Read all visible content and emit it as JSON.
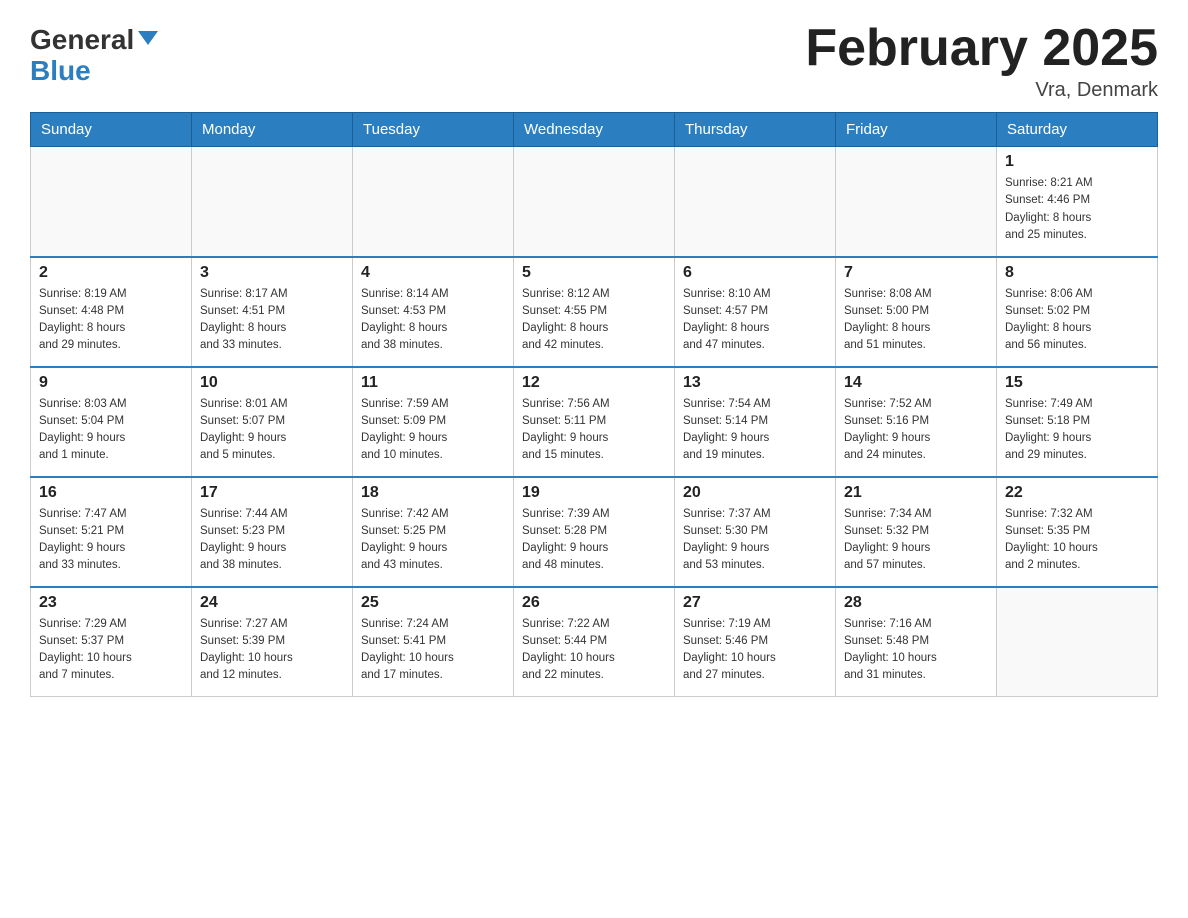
{
  "header": {
    "logo_general": "General",
    "logo_blue": "Blue",
    "title": "February 2025",
    "location": "Vra, Denmark"
  },
  "weekdays": [
    "Sunday",
    "Monday",
    "Tuesday",
    "Wednesday",
    "Thursday",
    "Friday",
    "Saturday"
  ],
  "weeks": [
    [
      {
        "day": "",
        "info": ""
      },
      {
        "day": "",
        "info": ""
      },
      {
        "day": "",
        "info": ""
      },
      {
        "day": "",
        "info": ""
      },
      {
        "day": "",
        "info": ""
      },
      {
        "day": "",
        "info": ""
      },
      {
        "day": "1",
        "info": "Sunrise: 8:21 AM\nSunset: 4:46 PM\nDaylight: 8 hours\nand 25 minutes."
      }
    ],
    [
      {
        "day": "2",
        "info": "Sunrise: 8:19 AM\nSunset: 4:48 PM\nDaylight: 8 hours\nand 29 minutes."
      },
      {
        "day": "3",
        "info": "Sunrise: 8:17 AM\nSunset: 4:51 PM\nDaylight: 8 hours\nand 33 minutes."
      },
      {
        "day": "4",
        "info": "Sunrise: 8:14 AM\nSunset: 4:53 PM\nDaylight: 8 hours\nand 38 minutes."
      },
      {
        "day": "5",
        "info": "Sunrise: 8:12 AM\nSunset: 4:55 PM\nDaylight: 8 hours\nand 42 minutes."
      },
      {
        "day": "6",
        "info": "Sunrise: 8:10 AM\nSunset: 4:57 PM\nDaylight: 8 hours\nand 47 minutes."
      },
      {
        "day": "7",
        "info": "Sunrise: 8:08 AM\nSunset: 5:00 PM\nDaylight: 8 hours\nand 51 minutes."
      },
      {
        "day": "8",
        "info": "Sunrise: 8:06 AM\nSunset: 5:02 PM\nDaylight: 8 hours\nand 56 minutes."
      }
    ],
    [
      {
        "day": "9",
        "info": "Sunrise: 8:03 AM\nSunset: 5:04 PM\nDaylight: 9 hours\nand 1 minute."
      },
      {
        "day": "10",
        "info": "Sunrise: 8:01 AM\nSunset: 5:07 PM\nDaylight: 9 hours\nand 5 minutes."
      },
      {
        "day": "11",
        "info": "Sunrise: 7:59 AM\nSunset: 5:09 PM\nDaylight: 9 hours\nand 10 minutes."
      },
      {
        "day": "12",
        "info": "Sunrise: 7:56 AM\nSunset: 5:11 PM\nDaylight: 9 hours\nand 15 minutes."
      },
      {
        "day": "13",
        "info": "Sunrise: 7:54 AM\nSunset: 5:14 PM\nDaylight: 9 hours\nand 19 minutes."
      },
      {
        "day": "14",
        "info": "Sunrise: 7:52 AM\nSunset: 5:16 PM\nDaylight: 9 hours\nand 24 minutes."
      },
      {
        "day": "15",
        "info": "Sunrise: 7:49 AM\nSunset: 5:18 PM\nDaylight: 9 hours\nand 29 minutes."
      }
    ],
    [
      {
        "day": "16",
        "info": "Sunrise: 7:47 AM\nSunset: 5:21 PM\nDaylight: 9 hours\nand 33 minutes."
      },
      {
        "day": "17",
        "info": "Sunrise: 7:44 AM\nSunset: 5:23 PM\nDaylight: 9 hours\nand 38 minutes."
      },
      {
        "day": "18",
        "info": "Sunrise: 7:42 AM\nSunset: 5:25 PM\nDaylight: 9 hours\nand 43 minutes."
      },
      {
        "day": "19",
        "info": "Sunrise: 7:39 AM\nSunset: 5:28 PM\nDaylight: 9 hours\nand 48 minutes."
      },
      {
        "day": "20",
        "info": "Sunrise: 7:37 AM\nSunset: 5:30 PM\nDaylight: 9 hours\nand 53 minutes."
      },
      {
        "day": "21",
        "info": "Sunrise: 7:34 AM\nSunset: 5:32 PM\nDaylight: 9 hours\nand 57 minutes."
      },
      {
        "day": "22",
        "info": "Sunrise: 7:32 AM\nSunset: 5:35 PM\nDaylight: 10 hours\nand 2 minutes."
      }
    ],
    [
      {
        "day": "23",
        "info": "Sunrise: 7:29 AM\nSunset: 5:37 PM\nDaylight: 10 hours\nand 7 minutes."
      },
      {
        "day": "24",
        "info": "Sunrise: 7:27 AM\nSunset: 5:39 PM\nDaylight: 10 hours\nand 12 minutes."
      },
      {
        "day": "25",
        "info": "Sunrise: 7:24 AM\nSunset: 5:41 PM\nDaylight: 10 hours\nand 17 minutes."
      },
      {
        "day": "26",
        "info": "Sunrise: 7:22 AM\nSunset: 5:44 PM\nDaylight: 10 hours\nand 22 minutes."
      },
      {
        "day": "27",
        "info": "Sunrise: 7:19 AM\nSunset: 5:46 PM\nDaylight: 10 hours\nand 27 minutes."
      },
      {
        "day": "28",
        "info": "Sunrise: 7:16 AM\nSunset: 5:48 PM\nDaylight: 10 hours\nand 31 minutes."
      },
      {
        "day": "",
        "info": ""
      }
    ]
  ]
}
